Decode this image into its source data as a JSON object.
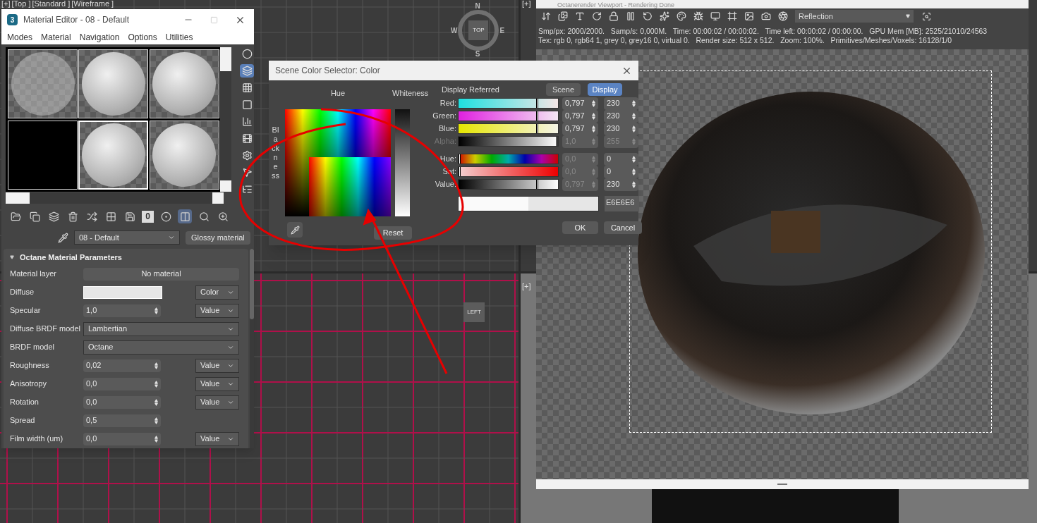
{
  "viewport_top": {
    "labels": [
      "[+]",
      "[Top ]",
      "[Standard ]",
      "[Wireframe ]"
    ],
    "compass": {
      "cube": "TOP",
      "north": "N",
      "south": "S",
      "east": "E",
      "west": "W"
    }
  },
  "viewport_right_top": {
    "label": "[+]"
  },
  "viewport_left": {
    "cube": "LEFT"
  },
  "viewport_right_bottom": {
    "label": "[+]"
  },
  "material_editor": {
    "title": "Material Editor - 08 - Default",
    "app_badge": "3",
    "menu": [
      "Modes",
      "Material",
      "Navigation",
      "Options",
      "Utilities"
    ],
    "slots": [
      {
        "kind": "glass",
        "selected": false
      },
      {
        "kind": "sphere",
        "selected": false
      },
      {
        "kind": "sphere",
        "selected": false
      },
      {
        "kind": "empty",
        "selected": false
      },
      {
        "kind": "sphere",
        "selected": true
      },
      {
        "kind": "sphere",
        "selected": false
      }
    ],
    "side_tools": [
      {
        "active": false
      },
      {
        "active": true
      },
      {
        "active": false
      },
      {
        "active": false
      },
      {
        "active": false
      },
      {
        "active": false
      },
      {
        "active": false
      },
      {
        "active": false
      },
      {
        "active": false
      }
    ],
    "bottom_tools": [
      {
        "active": false
      },
      {
        "active": false
      },
      {
        "active": false
      },
      {
        "active": false
      },
      {
        "active": false
      },
      {
        "active": false
      },
      {
        "active": false
      },
      {
        "active": false
      },
      {
        "active": false
      },
      {
        "active": true
      },
      {
        "active": false
      },
      {
        "active": false
      }
    ],
    "zero_button": "0",
    "material_name": "08 - Default",
    "material_type": "Glossy material",
    "rollout": {
      "title": "Octane Material Parameters",
      "expanded": true,
      "params": [
        {
          "kind": "button",
          "label": "Material layer",
          "value": "No material"
        },
        {
          "kind": "swatch",
          "label": "Diffuse",
          "mode": "Color"
        },
        {
          "kind": "spinner",
          "label": "Specular",
          "value": "1,0",
          "mode": "Value"
        },
        {
          "kind": "dropdown",
          "label": "Diffuse BRDF model",
          "value": "Lambertian"
        },
        {
          "kind": "dropdown",
          "label": "BRDF model",
          "value": "Octane"
        },
        {
          "kind": "spinner",
          "label": "Roughness",
          "value": "0,02",
          "mode": "Value"
        },
        {
          "kind": "spinner",
          "label": "Anisotropy",
          "value": "0,0",
          "mode": "Value"
        },
        {
          "kind": "spinner",
          "label": "Rotation",
          "value": "0,0",
          "mode": "Value"
        },
        {
          "kind": "spinner",
          "label": "Spread",
          "value": "0,5"
        },
        {
          "kind": "spinner",
          "label": "Film width (um)",
          "value": "0,0",
          "mode": "Value"
        }
      ]
    }
  },
  "color_dialog": {
    "title": "Scene Color Selector: Color",
    "hue_label": "Hue",
    "whiteness_label": "Whiteness",
    "blackness_label": "Blackness",
    "referred_label": "Display Referred",
    "modes": [
      {
        "label": "Scene",
        "selected": false
      },
      {
        "label": "Display",
        "selected": true
      }
    ],
    "channels": [
      {
        "kind": "red",
        "label": "Red:",
        "scene": "0,797",
        "display": "230",
        "level": 0.797,
        "disabled": false
      },
      {
        "kind": "green",
        "label": "Green:",
        "scene": "0,797",
        "display": "230",
        "level": 0.797,
        "disabled": false
      },
      {
        "kind": "blue",
        "label": "Blue:",
        "scene": "0,797",
        "display": "230",
        "level": 0.797,
        "disabled": false
      },
      {
        "kind": "alpha",
        "label": "Alpha:",
        "scene": "1,0",
        "display": "255",
        "level": 1,
        "disabled": true
      },
      {
        "kind": "hue",
        "label": "Hue:",
        "scene": "0,0",
        "display": "0",
        "level": 0,
        "disabled": false
      },
      {
        "kind": "sat",
        "label": "Sat:",
        "scene": "0,0",
        "display": "0",
        "level": 0,
        "disabled": false
      },
      {
        "kind": "value",
        "label": "Value:",
        "scene": "0,797",
        "display": "230",
        "level": 0.797,
        "disabled": false
      }
    ],
    "hex": "E6E6E6",
    "reset": "Reset",
    "ok": "OK",
    "cancel": "Cancel"
  },
  "render_window": {
    "title": "Octanerender Viewport - Rendering Done",
    "pass": "Reflection",
    "stats": [
      "Smp/px: 2000/2000.   Samp/s: 0,000M.   Time: 00:00:02 / 00:00:02.   Time left: 00:00:02 / 00:00:00.   GPU Mem [MB]: 2525/21010/24563",
      "Tex: rgb 0, rgb64 1, grey 0, grey16 0, virtual 0.   Render size: 512 x 512.   Zoom: 100%.   Primitives/Meshes/Voxels: 16128/1/0"
    ]
  }
}
